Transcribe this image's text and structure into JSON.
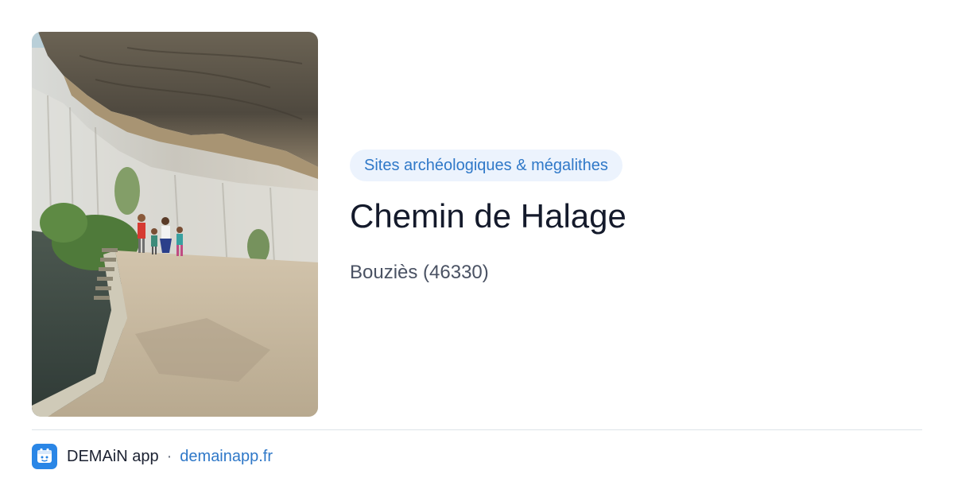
{
  "place": {
    "category": "Sites archéologiques & mégalithes",
    "name": "Chemin de Halage",
    "location": "Bouziès (46330)"
  },
  "photo": {
    "subject": "towpath-under-cliff-photo"
  },
  "footer": {
    "app_icon": "demain-app-icon",
    "app_name": "DEMAiN app",
    "separator": "·",
    "domain": "demainapp.fr"
  },
  "colors": {
    "badge_background": "#ecf3fd",
    "badge_text": "#2f78c8",
    "title_text": "#141a2b",
    "subtitle_text": "#4a5263",
    "link": "#2f78c8",
    "app_icon": "#2a86e6",
    "divider": "#dde3e8"
  }
}
